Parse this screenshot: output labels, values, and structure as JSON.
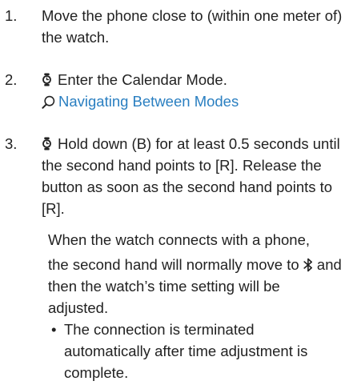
{
  "steps": [
    {
      "number": "1.",
      "text": "Move the phone close to (within one meter of) the watch."
    },
    {
      "number": "2.",
      "icon": "watch-icon",
      "text": "Enter the Calendar Mode.",
      "link": {
        "icon": "magnifier-icon",
        "text": "Navigating Between Modes"
      }
    },
    {
      "number": "3.",
      "icon": "watch-icon",
      "text": "Hold down (B) for at least 0.5 seconds until the second hand points to [R]. Release the button as soon as the second hand points to [R]."
    }
  ],
  "note": {
    "line1": "When the watch connects with a phone,",
    "line2_before_icon": "the second hand will normally move to",
    "line2_icon": "bluetooth-icon",
    "line2_after_icon": "and then the watch’s time setting will be adjusted."
  },
  "bullet": {
    "marker": "•",
    "text": "The connection is terminated automatically after time adjustment is complete."
  },
  "colors": {
    "text": "#222222",
    "link": "#2a7fc1"
  }
}
